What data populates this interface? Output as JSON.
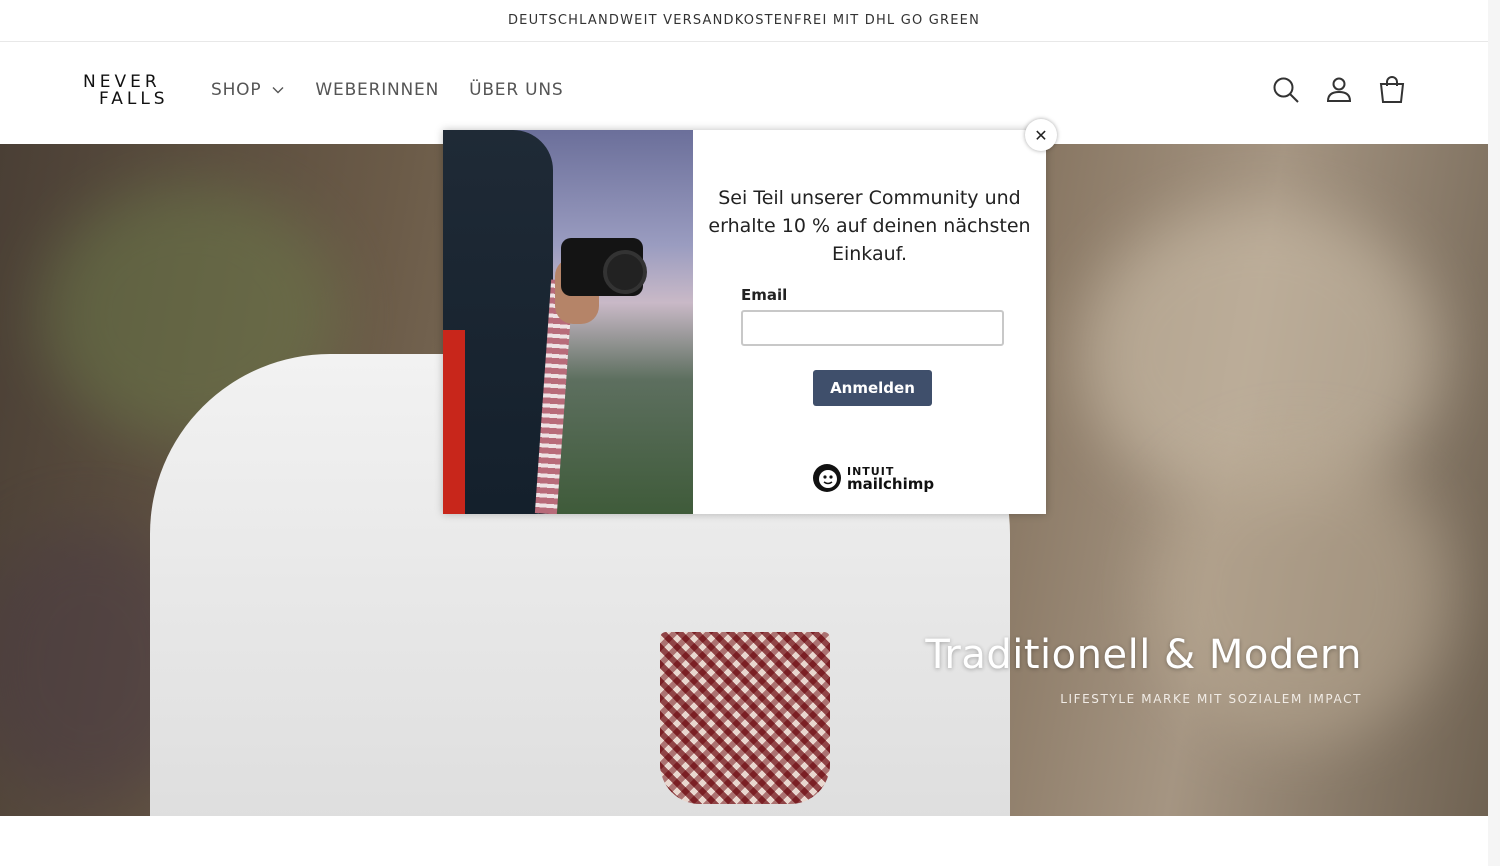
{
  "announcement": {
    "text": "DEUTSCHLANDWEIT VERSANDKOSTENFREI MIT DHL GO GREEN"
  },
  "header": {
    "logo_line1": "NEVER",
    "logo_line2": "FALLS",
    "nav": [
      {
        "label": "SHOP",
        "has_dropdown": true
      },
      {
        "label": "WEBERINNEN"
      },
      {
        "label": "ÜBER UNS"
      }
    ],
    "icons": [
      "search-icon",
      "account-icon",
      "cart-icon"
    ]
  },
  "hero": {
    "title": "Traditionell & Modern",
    "subtitle": "LIFESTYLE MARKE MIT SOZIALEM IMPACT"
  },
  "popup": {
    "heading": "Sei Teil unserer Community und erhalte 10 % auf deinen nächsten Einkauf.",
    "email_label": "Email",
    "email_value": "",
    "submit_label": "Anmelden",
    "brand_line1": "INTUIT",
    "brand_line2": "mailchimp",
    "close_symbol": "✕"
  },
  "colors": {
    "button_bg": "#3f4f6b",
    "hero_text": "#ffffff"
  }
}
